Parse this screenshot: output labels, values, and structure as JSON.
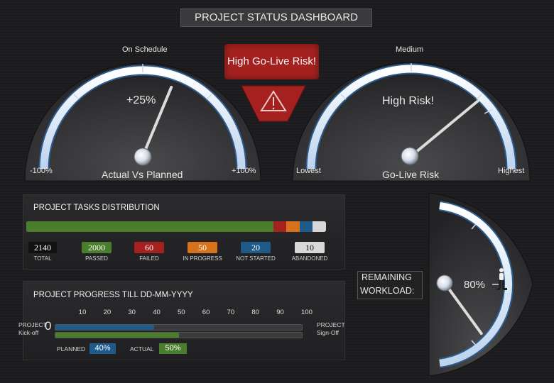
{
  "header": {
    "title": "PROJECT STATUS DASHBOARD"
  },
  "gauge_schedule": {
    "top_label": "On Schedule",
    "value_label": "+25%",
    "min_label": "-100%",
    "max_label": "+100%",
    "caption": "Actual Vs Planned",
    "value_percent": 25,
    "range": [
      -100,
      100
    ]
  },
  "gauge_risk": {
    "top_label": "Medium",
    "value_label": "High Risk!",
    "min_label": "Lowest",
    "max_label": "Highest",
    "caption": "Go-Live Risk",
    "value_fraction": 0.78
  },
  "alert": {
    "banner_text": "High Go-Live Risk!",
    "icon": "warning-triangle-icon",
    "color": "#a4211f"
  },
  "tasks": {
    "title": "PROJECT TASKS DISTRIBUTION",
    "total": {
      "value": "2140",
      "caption": "TOTAL"
    },
    "items": [
      {
        "value": "2000",
        "caption": "PASSED",
        "color": "#4a7d2c"
      },
      {
        "value": "60",
        "caption": "FAILED",
        "color": "#a4211f"
      },
      {
        "value": "50",
        "caption": "IN PROGRESS",
        "color": "#d6711c"
      },
      {
        "value": "20",
        "caption": "NOT STARTED",
        "color": "#1e5a8a"
      },
      {
        "value": "10",
        "caption": "ABANDONED",
        "color": "#d8d8d8"
      }
    ]
  },
  "progress": {
    "title": "PROJECT PROGRESS TILL DD-MM-YYYY",
    "ticks": [
      "10",
      "20",
      "30",
      "40",
      "50",
      "60",
      "70",
      "80",
      "90",
      "100"
    ],
    "start_label_1": "PROJECT",
    "start_label_2": "Kick-off",
    "start_value": "0",
    "end_label_1": "PROJECT",
    "end_label_2": "Sign-Off",
    "planned_label": "PLANNED",
    "planned_value": "40%",
    "planned_fraction": 0.4,
    "actual_label": "ACTUAL",
    "actual_value": "50%",
    "actual_fraction": 0.5,
    "planned_color": "#1e5a8a",
    "actual_color": "#4a7d2c",
    "flag_color": "#c8161e"
  },
  "workload": {
    "label_1": "REMAINING",
    "label_2": "WORKLOAD:",
    "value_label": "80%",
    "value_fraction": 0.8
  }
}
